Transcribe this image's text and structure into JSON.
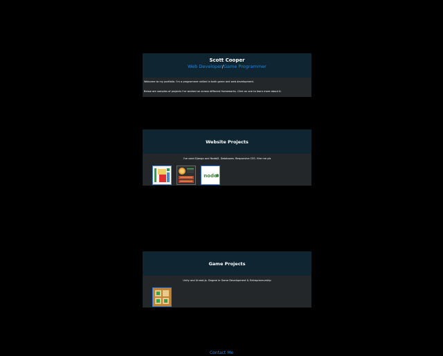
{
  "header": {
    "name": "Scott Cooper",
    "role_web": "Web Developer",
    "role_separator": "/",
    "role_game": "Game Programmer"
  },
  "intro": {
    "line1": "Welcome to my portfolio. I'm a programmer skilled in both game and web development.",
    "line2": "Below are samples of projects I've worked on across different frameworks. Click on one to learn more about it."
  },
  "web_section": {
    "title": "Website Projects",
    "description": "I've used Django and NodeJS. Databases. Responsive CSS. Hire me pls",
    "thumbnails": [
      "web-project-1-thumbnail",
      "web-project-2-thumbnail",
      "nodejs-project-thumbnail"
    ],
    "node_logo_text": "node"
  },
  "game_section": {
    "title": "Game Projects",
    "description": "Unity and Unreal.js. Degree in Game Development & Entrepreneurship",
    "thumbnails": [
      "game-project-1-thumbnail"
    ]
  },
  "footer": {
    "contact_label": "Contact Me"
  },
  "colors": {
    "background": "#000000",
    "card_header": "#0f2532",
    "card_body": "#242729",
    "accent_link": "#1e88e5",
    "node_green": "#43853d"
  }
}
